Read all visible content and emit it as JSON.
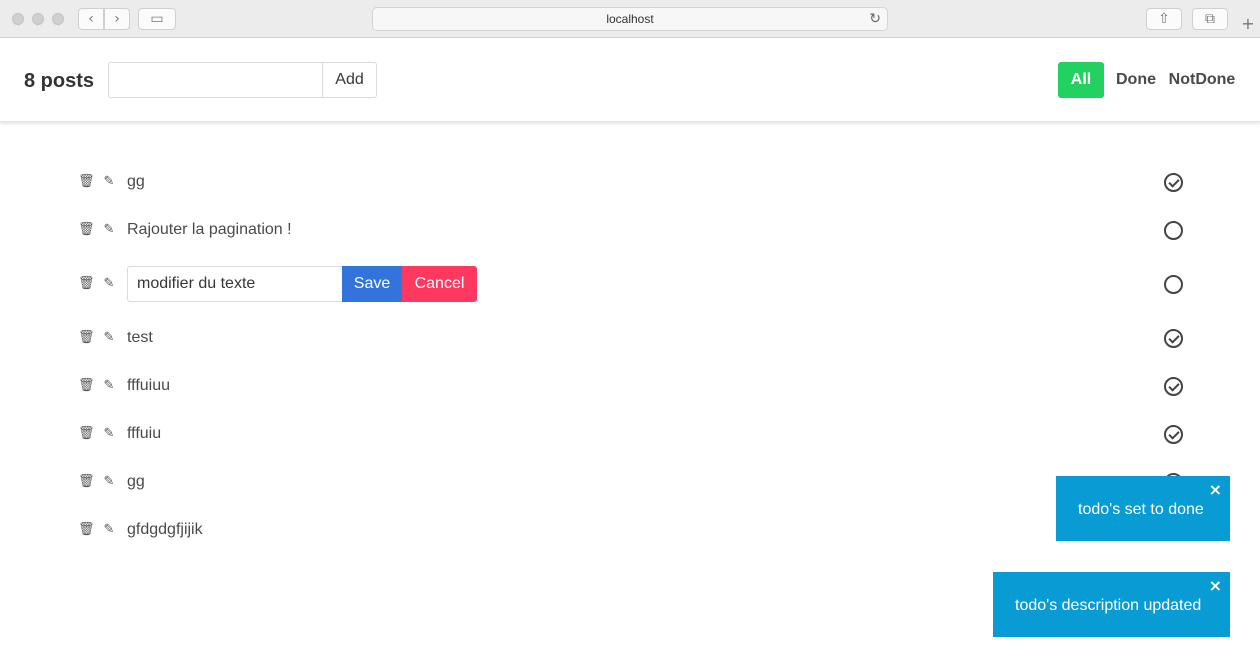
{
  "browser": {
    "url": "localhost",
    "back_glyph": "‹",
    "forward_glyph": "›",
    "sidebar_glyph": "▭",
    "reload_glyph": "↻",
    "share_glyph": "⇧",
    "tabs_glyph": "⧉",
    "newtab_glyph": "+"
  },
  "header": {
    "post_count": "8 posts",
    "add_input_value": "",
    "add_label": "Add",
    "filters": [
      {
        "label": "All",
        "active": true
      },
      {
        "label": "Done",
        "active": false
      },
      {
        "label": "NotDone",
        "active": false
      }
    ]
  },
  "icons": {
    "delete": "🗑",
    "edit": "✎"
  },
  "todos": [
    {
      "text": "gg",
      "done": true
    },
    {
      "text": "Rajouter la pagination !",
      "done": false
    },
    {
      "text": "modifier du texte",
      "done": false,
      "editing": true
    },
    {
      "text": "test",
      "done": true
    },
    {
      "text": "fffuiuu",
      "done": true
    },
    {
      "text": "fffuiu",
      "done": true
    },
    {
      "text": "gg",
      "done": true
    },
    {
      "text": "gfdgdgfjijik",
      "done": false
    }
  ],
  "edit": {
    "save_label": "Save",
    "cancel_label": "Cancel"
  },
  "notifications": [
    {
      "message": "todo's set to done",
      "close": "×"
    },
    {
      "message": "todo's description updated",
      "close": "×"
    }
  ],
  "colors": {
    "all_filter": "#23d160",
    "save": "#3273dc",
    "cancel": "#ff3860",
    "notification": "#099bd3"
  }
}
